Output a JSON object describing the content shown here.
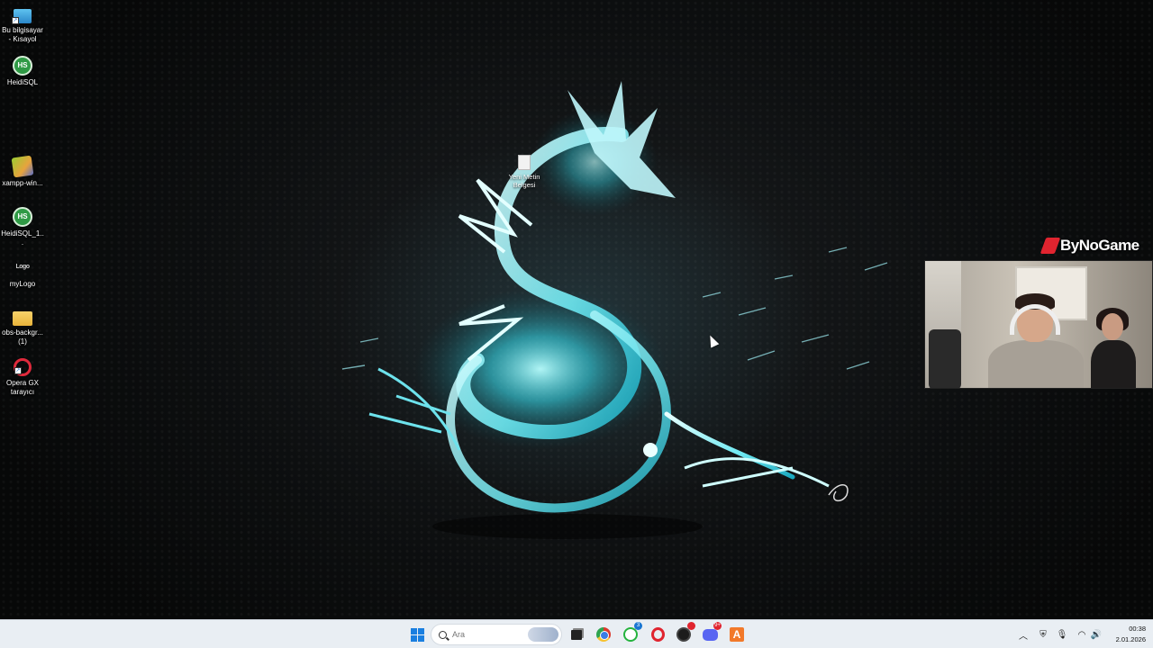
{
  "desktop": {
    "icons": [
      {
        "label": "Bu bilgisayar - Kısayol",
        "icon": "computer-icon"
      },
      {
        "label": "HeidiSQL",
        "icon": "heidisql-icon",
        "glyph": "HS"
      },
      {
        "label": "xampp-win...",
        "icon": "xampp-icon"
      },
      {
        "label": "HeidiSQL_1...",
        "icon": "heidisql-icon",
        "glyph": "HS"
      },
      {
        "label": "myLogo",
        "icon": "image-icon",
        "glyph": "Logo"
      },
      {
        "label": "obs-backgr... (1)",
        "icon": "folder-icon"
      },
      {
        "label": "Opera GX tarayıcı",
        "icon": "opera-gx-icon"
      }
    ],
    "center_icon": {
      "label": "Yeni Metin Belgesi",
      "icon": "text-document-icon"
    }
  },
  "overlay": {
    "brand": "ByNoGame",
    "brand_color": "#e0242f"
  },
  "taskbar": {
    "search_placeholder": "Ara",
    "pinned": [
      {
        "name": "task-view",
        "icon": "task-view-icon"
      },
      {
        "name": "chrome",
        "icon": "chrome-icon"
      },
      {
        "name": "whatsapp",
        "icon": "whatsapp-icon",
        "badge": "3"
      },
      {
        "name": "opera",
        "icon": "opera-icon"
      },
      {
        "name": "opera-gx",
        "icon": "opera-gx-icon"
      },
      {
        "name": "discord",
        "icon": "discord-icon",
        "badge": "9+"
      },
      {
        "name": "avast",
        "icon": "avast-icon"
      }
    ],
    "tray_icons": [
      "chevron-up-icon",
      "security-icon",
      "microphone-icon",
      "wifi-icon",
      "volume-icon"
    ],
    "time": "00:38",
    "date": "2.01.2026",
    "accent": "#1a7fe0"
  }
}
